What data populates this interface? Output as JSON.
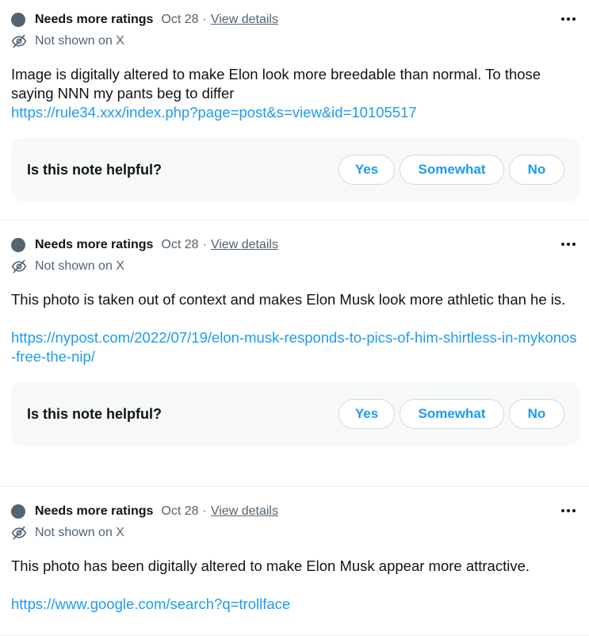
{
  "notes": [
    {
      "status": "Needs more ratings",
      "date": "Oct 28",
      "separator": "·",
      "details_link": "View details",
      "visibility": "Not shown on X",
      "text": "Image is digitally altered to make Elon look more breedable than normal. To those saying NNN my pants beg to differ",
      "link": "https://rule34.xxx/index.php?page=post&s=view&id=10105517",
      "question": "Is this note helpful?",
      "yes": "Yes",
      "somewhat": "Somewhat",
      "no": "No"
    },
    {
      "status": "Needs more ratings",
      "date": "Oct 28",
      "separator": "·",
      "details_link": "View details",
      "visibility": "Not shown on X",
      "text": "This photo is taken out of context and makes Elon Musk look more athletic than he is.",
      "link": "https://nypost.com/2022/07/19/elon-musk-responds-to-pics-of-him-shirtless-in-mykonos-free-the-nip/",
      "question": "Is this note helpful?",
      "yes": "Yes",
      "somewhat": "Somewhat",
      "no": "No"
    },
    {
      "status": "Needs more ratings",
      "date": "Oct 28",
      "separator": "·",
      "details_link": "View details",
      "visibility": "Not shown on X",
      "text": "This photo has been digitally altered to make Elon Musk appear more attractive.",
      "link": "https://www.google.com/search?q=trollface"
    }
  ],
  "colors": {
    "accent": "#1d9bf0",
    "muted": "#536471",
    "status_dot": "#536471",
    "helpful_bg": "#f7f9f9"
  },
  "icons": {
    "status": "status-dot-icon",
    "visibility": "eye-off-icon",
    "more": "more-options-icon"
  }
}
